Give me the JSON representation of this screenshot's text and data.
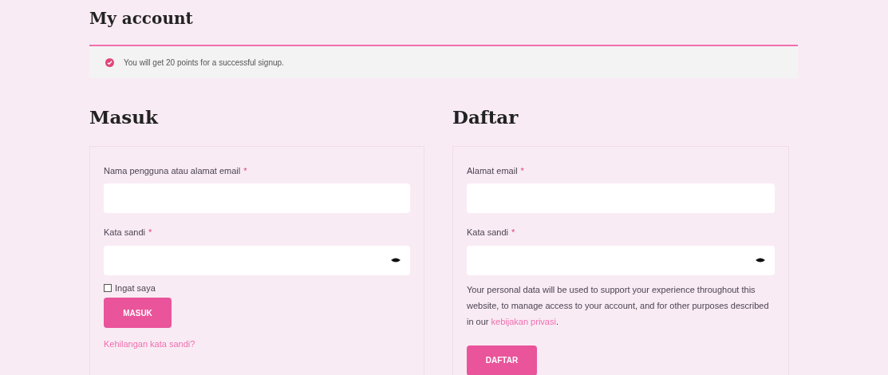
{
  "page_title": "My account",
  "notice": {
    "text": "You will get 20 points for a successful signup."
  },
  "login": {
    "heading": "Masuk",
    "fields": [
      {
        "label": "Nama pengguna atau alamat email",
        "required_mark": "*",
        "kind": "text"
      },
      {
        "label": "Kata sandi",
        "required_mark": "*",
        "kind": "password"
      }
    ],
    "remember": {
      "label": "Ingat saya",
      "checked": false
    },
    "button": "MASUK",
    "lost_password": "Kehilangan kata sandi?"
  },
  "register": {
    "heading": "Daftar",
    "fields": [
      {
        "label": "Alamat email",
        "required_mark": "*",
        "kind": "text"
      },
      {
        "label": "Kata sandi",
        "required_mark": "*",
        "kind": "password"
      }
    ],
    "privacy": {
      "before": "Your personal data will be used to support your experience throughout this website, to manage access to your account, and for other purposes described in our ",
      "link": "kebijakan privasi",
      "after": "."
    },
    "button": "DAFTAR"
  }
}
